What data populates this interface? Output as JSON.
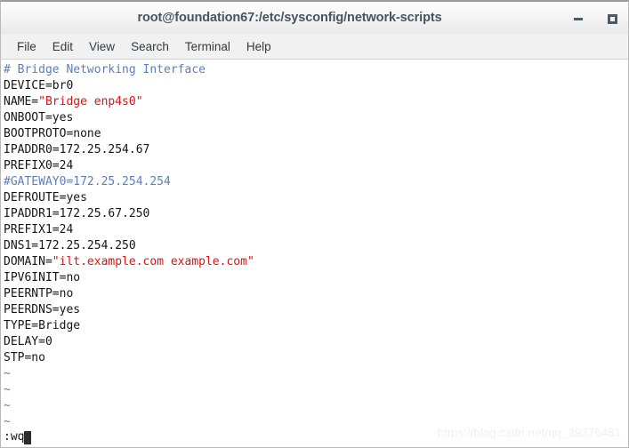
{
  "window": {
    "title": "root@foundation67:/etc/sysconfig/network-scripts",
    "controls": {
      "minimize_label": "–",
      "maximize_label": "□"
    }
  },
  "menubar": {
    "items": [
      {
        "label": "File"
      },
      {
        "label": "Edit"
      },
      {
        "label": "View"
      },
      {
        "label": "Search"
      },
      {
        "label": "Terminal"
      },
      {
        "label": "Help"
      }
    ]
  },
  "editor": {
    "lines": [
      {
        "segments": [
          {
            "text": "# Bridge Networking Interface",
            "style": "comment"
          }
        ]
      },
      {
        "segments": [
          {
            "text": "DEVICE=br0",
            "style": "plain"
          }
        ]
      },
      {
        "segments": [
          {
            "text": "NAME=",
            "style": "plain"
          },
          {
            "text": "\"Bridge enp4s0\"",
            "style": "string"
          }
        ]
      },
      {
        "segments": [
          {
            "text": "ONBOOT=yes",
            "style": "plain"
          }
        ]
      },
      {
        "segments": [
          {
            "text": "BOOTPROTO=none",
            "style": "plain"
          }
        ]
      },
      {
        "segments": [
          {
            "text": "IPADDR0=172.25.254.67",
            "style": "plain"
          }
        ]
      },
      {
        "segments": [
          {
            "text": "PREFIX0=24",
            "style": "plain"
          }
        ]
      },
      {
        "segments": [
          {
            "text": "#GATEWAY0=172.25.254.254",
            "style": "comment"
          }
        ]
      },
      {
        "segments": [
          {
            "text": "DEFROUTE=yes",
            "style": "plain"
          }
        ]
      },
      {
        "segments": [
          {
            "text": "IPADDR1=172.25.67.250",
            "style": "plain"
          }
        ]
      },
      {
        "segments": [
          {
            "text": "PREFIX1=24",
            "style": "plain"
          }
        ]
      },
      {
        "segments": [
          {
            "text": "DNS1=172.25.254.250",
            "style": "plain"
          }
        ]
      },
      {
        "segments": [
          {
            "text": "DOMAIN=",
            "style": "plain"
          },
          {
            "text": "\"ilt.example.com example.com\"",
            "style": "string"
          }
        ]
      },
      {
        "segments": [
          {
            "text": "IPV6INIT=no",
            "style": "plain"
          }
        ]
      },
      {
        "segments": [
          {
            "text": "PEERNTP=no",
            "style": "plain"
          }
        ]
      },
      {
        "segments": [
          {
            "text": "PEERDNS=yes",
            "style": "plain"
          }
        ]
      },
      {
        "segments": [
          {
            "text": "TYPE=Bridge",
            "style": "plain"
          }
        ]
      },
      {
        "segments": [
          {
            "text": "DELAY=0",
            "style": "plain"
          }
        ]
      },
      {
        "segments": [
          {
            "text": "STP=no",
            "style": "plain"
          }
        ]
      },
      {
        "segments": [
          {
            "text": "~",
            "style": "tilde"
          }
        ]
      },
      {
        "segments": [
          {
            "text": "~",
            "style": "tilde"
          }
        ]
      },
      {
        "segments": [
          {
            "text": "~",
            "style": "tilde"
          }
        ]
      },
      {
        "segments": [
          {
            "text": "~",
            "style": "tilde"
          }
        ]
      }
    ],
    "command_line": ":wq"
  },
  "watermark": {
    "text": "https://blog.csdn.net/qq_39376481"
  },
  "colors": {
    "comment": "#5c7fba",
    "string": "#d81515",
    "text": "#151515",
    "title": "#46555e",
    "background": "#ffffff"
  }
}
